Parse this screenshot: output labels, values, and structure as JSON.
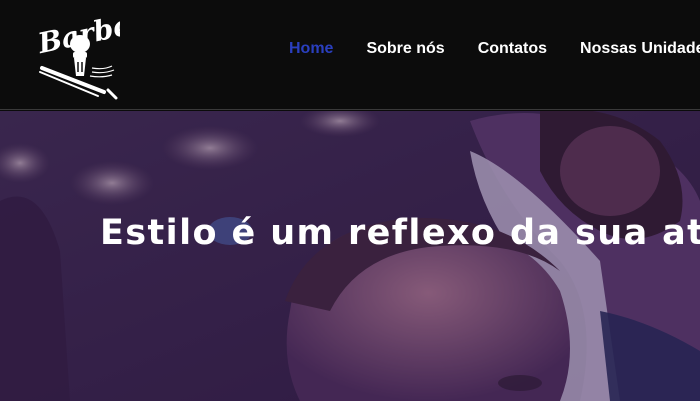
{
  "header": {
    "logo_text": "Barber",
    "logo_icon": "barber-logo-icon"
  },
  "nav": {
    "items": [
      {
        "label": "Home",
        "active": true
      },
      {
        "label": "Sobre nós",
        "active": false
      },
      {
        "label": "Contatos",
        "active": false
      },
      {
        "label": "Nossas Unidades",
        "active": false
      }
    ]
  },
  "hero": {
    "title": "Estilo é um reflexo da sua atitude"
  },
  "colors": {
    "header_bg": "#0c0c0c",
    "nav_active": "#2a3fbf",
    "nav_text": "#ffffff",
    "hero_overlay": "#3a1f5a"
  }
}
